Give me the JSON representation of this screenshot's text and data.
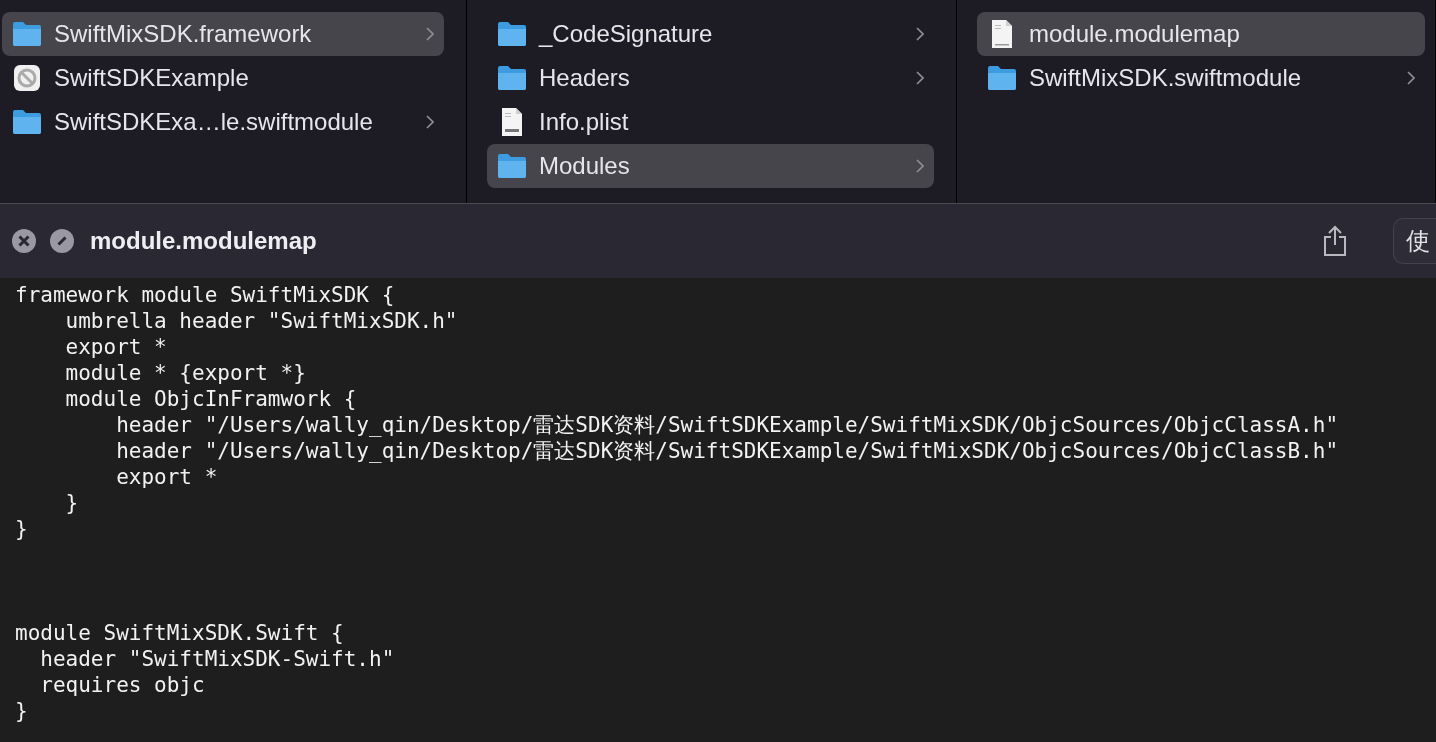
{
  "columns": [
    {
      "items": [
        {
          "name": "SwiftMixSDK.framework",
          "kind": "folder",
          "selected": true,
          "expandable": true
        },
        {
          "name": "SwiftSDKExample",
          "kind": "app",
          "selected": false,
          "expandable": false
        },
        {
          "name": "SwiftSDKExa…le.swiftmodule",
          "kind": "folder",
          "selected": false,
          "expandable": true
        }
      ]
    },
    {
      "items": [
        {
          "name": "_CodeSignature",
          "kind": "folder",
          "selected": false,
          "expandable": true
        },
        {
          "name": "Headers",
          "kind": "folder",
          "selected": false,
          "expandable": true
        },
        {
          "name": "Info.plist",
          "kind": "plist",
          "selected": false,
          "expandable": false
        },
        {
          "name": "Modules",
          "kind": "folder",
          "selected": true,
          "expandable": true
        }
      ]
    },
    {
      "items": [
        {
          "name": "module.modulemap",
          "kind": "file",
          "selected": true,
          "expandable": false
        },
        {
          "name": "SwiftMixSDK.swiftmodule",
          "kind": "folder",
          "selected": false,
          "expandable": true
        }
      ]
    }
  ],
  "preview": {
    "title": "module.modulemap",
    "open_button": "使",
    "code_blocks": [
      [
        "framework module SwiftMixSDK {",
        "    umbrella header \"SwiftMixSDK.h\"",
        "    export *",
        "    module * {export *}",
        "    module ObjcInFramwork {",
        "        header \"/Users/wally_qin/Desktop/雷达SDK资料/SwiftSDKExample/SwiftMixSDK/ObjcSources/ObjcClassA.h\"",
        "        header \"/Users/wally_qin/Desktop/雷达SDK资料/SwiftSDKExample/SwiftMixSDK/ObjcSources/ObjcClassB.h\"",
        "        export *",
        "    }",
        "}"
      ],
      [
        "module SwiftMixSDK.Swift {",
        "  header \"SwiftMixSDK-Swift.h\"",
        "  requires objc",
        "}"
      ]
    ]
  }
}
